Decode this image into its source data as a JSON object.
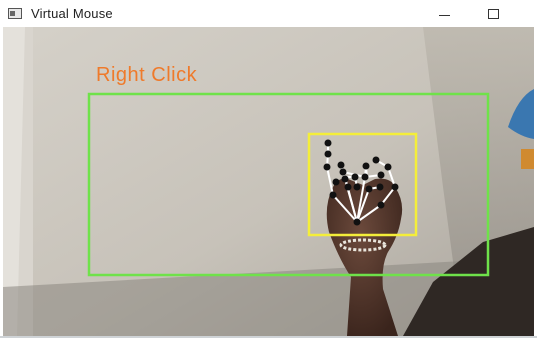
{
  "window": {
    "title": "Virtual Mouse",
    "icon": "opencv-window-icon",
    "controls": [
      "minimize-icon",
      "maximize-icon"
    ]
  },
  "overlay": {
    "gesture_label": "Right Click",
    "colors": {
      "gesture_label": "#ef7a2a",
      "tracking_frame": "#6fe24a",
      "hand_bbox": "#f4ee3a",
      "landmark_point": "#111111",
      "landmark_connection": "#ffffff"
    }
  }
}
